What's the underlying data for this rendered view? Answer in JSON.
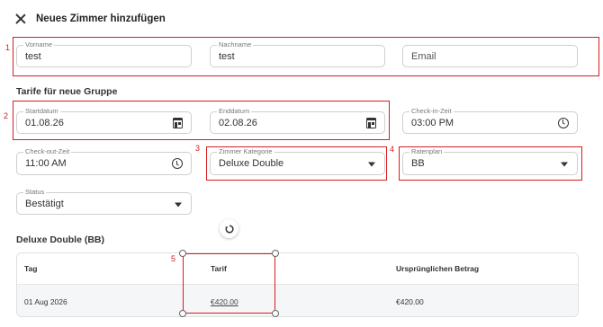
{
  "header": {
    "title": "Neues Zimmer hinzufügen"
  },
  "guest": {
    "firstname": {
      "label": "Vorname",
      "value": "test"
    },
    "lastname": {
      "label": "Nachname",
      "value": "test"
    },
    "email": {
      "placeholder": "Email"
    }
  },
  "rates_section": {
    "title": "Tarife für neue Gruppe",
    "start_date": {
      "label": "Startdatum",
      "value": "01.08.26"
    },
    "end_date": {
      "label": "Enddatum",
      "value": "02.08.26"
    },
    "checkin_time": {
      "label": "Check-in-Zeit",
      "value": "03:00 PM"
    },
    "checkout_time": {
      "label": "Check-out-Zeit",
      "value": "11:00 AM"
    },
    "room_category": {
      "label": "Zimmer Kategorie",
      "value": "Deluxe Double"
    },
    "rate_plan": {
      "label": "Ratenplan",
      "value": "BB"
    },
    "status": {
      "label": "Status",
      "value": "Bestätigt"
    }
  },
  "table": {
    "title": "Deluxe Double (BB)",
    "headers": [
      "Tag",
      "Tarif",
      "Ursprünglichen Betrag"
    ],
    "rows": [
      {
        "day": "01 Aug 2026",
        "rate": "€420.00",
        "original": "€420.00"
      }
    ]
  },
  "annotations": [
    "1",
    "2",
    "3",
    "4",
    "5"
  ],
  "colors": {
    "annotation": "#d61d1d",
    "border": "#cfcfcf",
    "row_bg": "#f5f6f7"
  },
  "icons": [
    "close-icon",
    "calendar-icon",
    "clock-icon",
    "caret-down-icon",
    "rotate-icon"
  ]
}
